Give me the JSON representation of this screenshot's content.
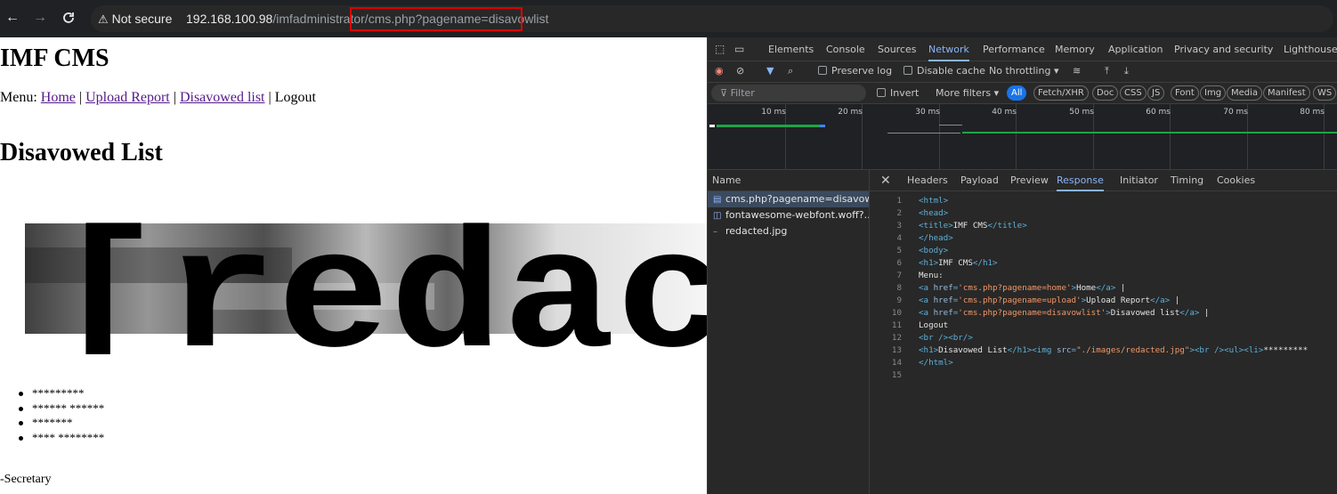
{
  "browser": {
    "back_icon": "←",
    "forward_icon": "→",
    "reload_icon": "C",
    "security_label": "Not secure",
    "url_host": "192.168.100.98",
    "url_dir": "/imfadministrator/",
    "url_page": "cms.php?pagename=disavowlist"
  },
  "page": {
    "site_title": "IMF CMS",
    "menu_prefix": "Menu:",
    "menu": [
      "Home",
      "Upload Report",
      "Disavowed list",
      "Logout"
    ],
    "heading": "Disavowed List",
    "image_text": "[redac",
    "list": [
      "*********",
      "****** ******",
      "*******",
      "**** ********"
    ],
    "signature": "-Secretary"
  },
  "devtools": {
    "tabs": [
      "Elements",
      "Console",
      "Sources",
      "Network",
      "Performance",
      "Memory",
      "Application",
      "Privacy and security",
      "Lighthouse"
    ],
    "active_tab": "Network",
    "toolbar": {
      "preserve_log": "Preserve log",
      "disable_cache": "Disable cache",
      "throttling": "No throttling"
    },
    "filter": {
      "placeholder": "Filter",
      "invert": "Invert",
      "more_filters": "More filters",
      "types": [
        "All",
        "Fetch/XHR",
        "Doc",
        "CSS",
        "JS",
        "Font",
        "Img",
        "Media",
        "Manifest",
        "WS"
      ]
    },
    "timeline_ticks": [
      "10 ms",
      "20 ms",
      "30 ms",
      "40 ms",
      "50 ms",
      "60 ms",
      "70 ms",
      "80 ms"
    ],
    "requests_header": "Name",
    "requests": [
      "cms.php?pagename=disavow...",
      "fontawesome-webfont.woff?...",
      "redacted.jpg"
    ],
    "detail_tabs": [
      "Headers",
      "Payload",
      "Preview",
      "Response",
      "Initiator",
      "Timing",
      "Cookies"
    ],
    "active_detail_tab": "Response",
    "response_lines": [
      "<html>",
      "<head>",
      "<title>IMF CMS</title>",
      "</head>",
      "<body>",
      "<h1>IMF CMS</h1>",
      "Menu:",
      "<a href='cms.php?pagename=home'>Home</a> |",
      "<a href='cms.php?pagename=upload'>Upload Report</a> |",
      "<a href='cms.php?pagename=disavowlist'>Disavowed list</a> |",
      "Logout",
      "<br /><br/>",
      "<h1>Disavowed List</h1><img src=\"./images/redacted.jpg\"><br /><ul><li>*********",
      "</html>",
      ""
    ]
  }
}
